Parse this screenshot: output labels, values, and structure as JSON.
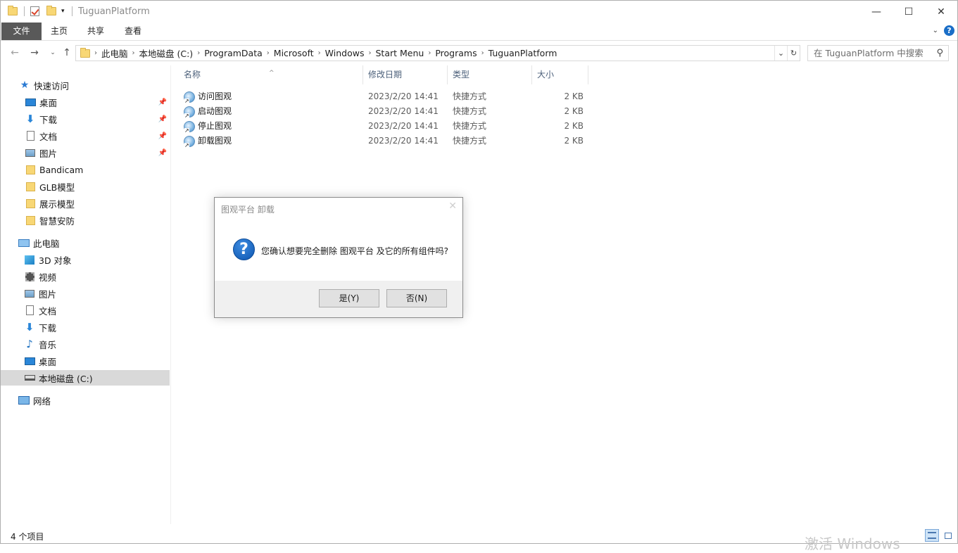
{
  "window": {
    "title": "TuguanPlatform",
    "controls": {
      "minimize": "—",
      "maximize": "☐",
      "close": "✕"
    }
  },
  "ribbon": {
    "tabs": [
      "文件",
      "主页",
      "共享",
      "查看"
    ],
    "help": "?"
  },
  "address": {
    "crumbs": [
      "此电脑",
      "本地磁盘 (C:)",
      "ProgramData",
      "Microsoft",
      "Windows",
      "Start Menu",
      "Programs",
      "TuguanPlatform"
    ]
  },
  "search": {
    "placeholder": "在 TuguanPlatform 中搜索"
  },
  "sidebar": {
    "quick_access": "快速访问",
    "quick_items": [
      "桌面",
      "下载",
      "文档",
      "图片",
      "Bandicam",
      "GLB模型",
      "展示模型",
      "智慧安防"
    ],
    "this_pc": "此电脑",
    "pc_items": [
      "3D 对象",
      "视频",
      "图片",
      "文档",
      "下载",
      "音乐",
      "桌面",
      "本地磁盘 (C:)"
    ],
    "network": "网络",
    "selected": "本地磁盘 (C:)"
  },
  "columns": {
    "name": "名称",
    "modified": "修改日期",
    "type": "类型",
    "size": "大小"
  },
  "files": [
    {
      "name": "访问图观",
      "modified": "2023/2/20 14:41",
      "type": "快捷方式",
      "size": "2 KB"
    },
    {
      "name": "启动图观",
      "modified": "2023/2/20 14:41",
      "type": "快捷方式",
      "size": "2 KB"
    },
    {
      "name": "停止图观",
      "modified": "2023/2/20 14:41",
      "type": "快捷方式",
      "size": "2 KB"
    },
    {
      "name": "卸载图观",
      "modified": "2023/2/20 14:41",
      "type": "快捷方式",
      "size": "2 KB"
    }
  ],
  "dialog": {
    "title": "图观平台 卸载",
    "message": "您确认想要完全删除 图观平台 及它的所有组件吗?",
    "yes": "是(Y)",
    "no": "否(N)",
    "close": "✕"
  },
  "status": {
    "count": "4 个项目"
  },
  "watermark": "激活 Windows"
}
